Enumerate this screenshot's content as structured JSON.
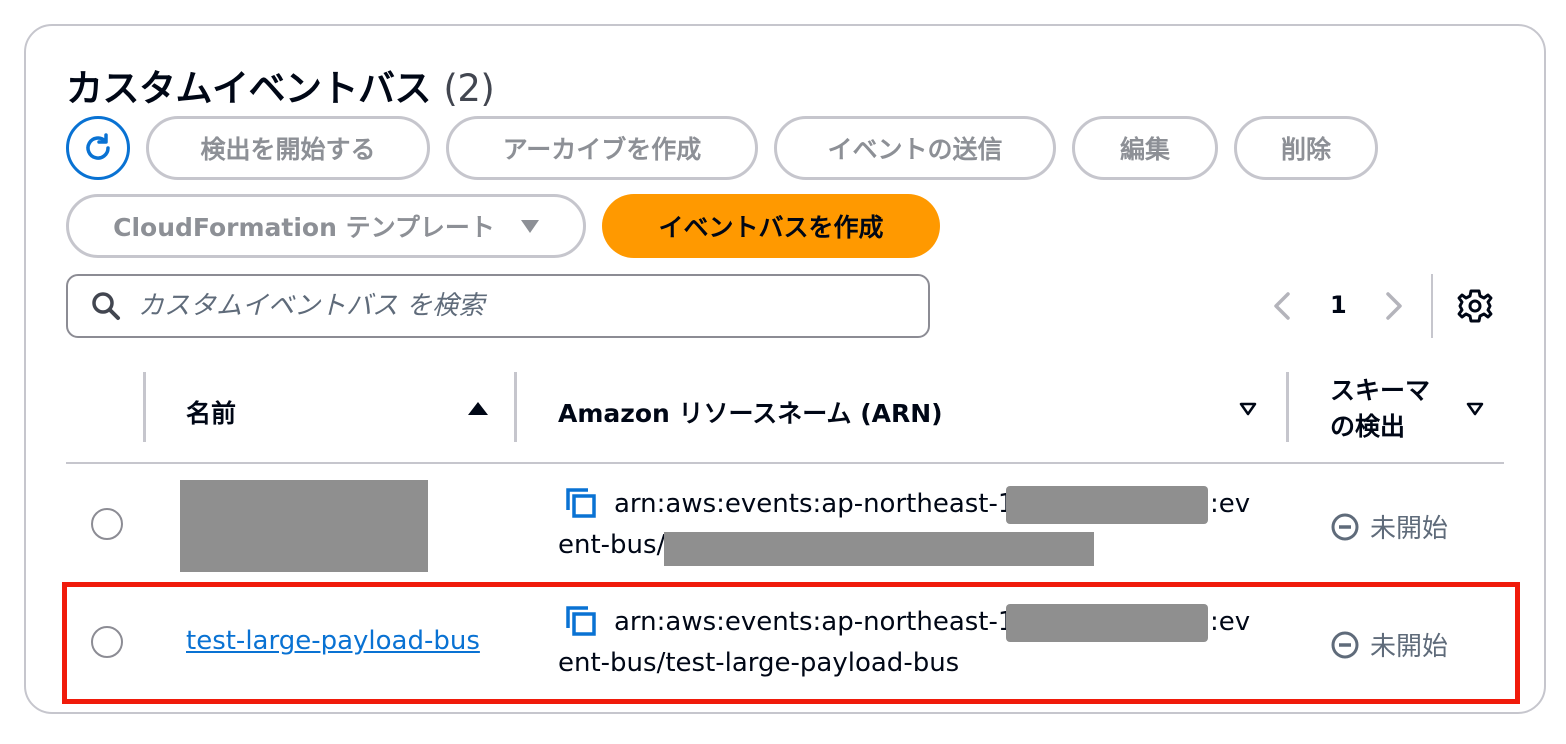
{
  "header": {
    "title": "カスタムイベントバス",
    "count": "(2)"
  },
  "toolbar": {
    "refresh_icon": "refresh-icon",
    "start_discovery": "検出を開始する",
    "create_archive": "アーカイブを作成",
    "send_event": "イベントの送信",
    "edit": "編集",
    "delete": "削除",
    "cloudformation": "CloudFormation テンプレート",
    "create_bus": "イベントバスを作成"
  },
  "search": {
    "placeholder": "カスタムイベントバス を検索"
  },
  "pagination": {
    "current_page": "1"
  },
  "table": {
    "columns": {
      "name": "名前",
      "arn": "Amazon リソースネーム (ARN)",
      "schema_line1": "スキーマ",
      "schema_line2": "の検出"
    },
    "rows": [
      {
        "name": "",
        "arn_prefix": "arn:aws:events:ap-northeast-1:",
        "arn_mid": ":ev",
        "arn_line2": "ent-bus/",
        "status": "未開始"
      },
      {
        "name": "test-large-payload-bus",
        "arn_prefix": "arn:aws:events:ap-northeast-1:",
        "arn_mid": ":ev",
        "arn_line2": "ent-bus/test-large-payload-bus",
        "status": "未開始"
      }
    ]
  },
  "colors": {
    "primary": "#ff9900",
    "link": "#0972d3",
    "highlight": "#f01b0b"
  }
}
